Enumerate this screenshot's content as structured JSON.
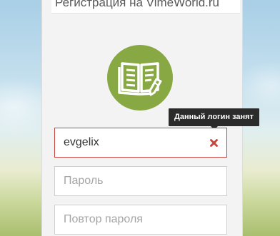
{
  "header": {
    "title": "Регистрация на VimeWorld.ru"
  },
  "logo": {
    "icon": "book-pencil-icon",
    "color": "#87a843"
  },
  "form": {
    "login": {
      "value": "evgelix",
      "error_tooltip": "Данный логин занят"
    },
    "password": {
      "placeholder": "Пароль"
    },
    "password_repeat": {
      "placeholder": "Повтор пароля"
    }
  },
  "colors": {
    "error": "#c3473e",
    "tooltip_bg": "#2b2b2b"
  }
}
